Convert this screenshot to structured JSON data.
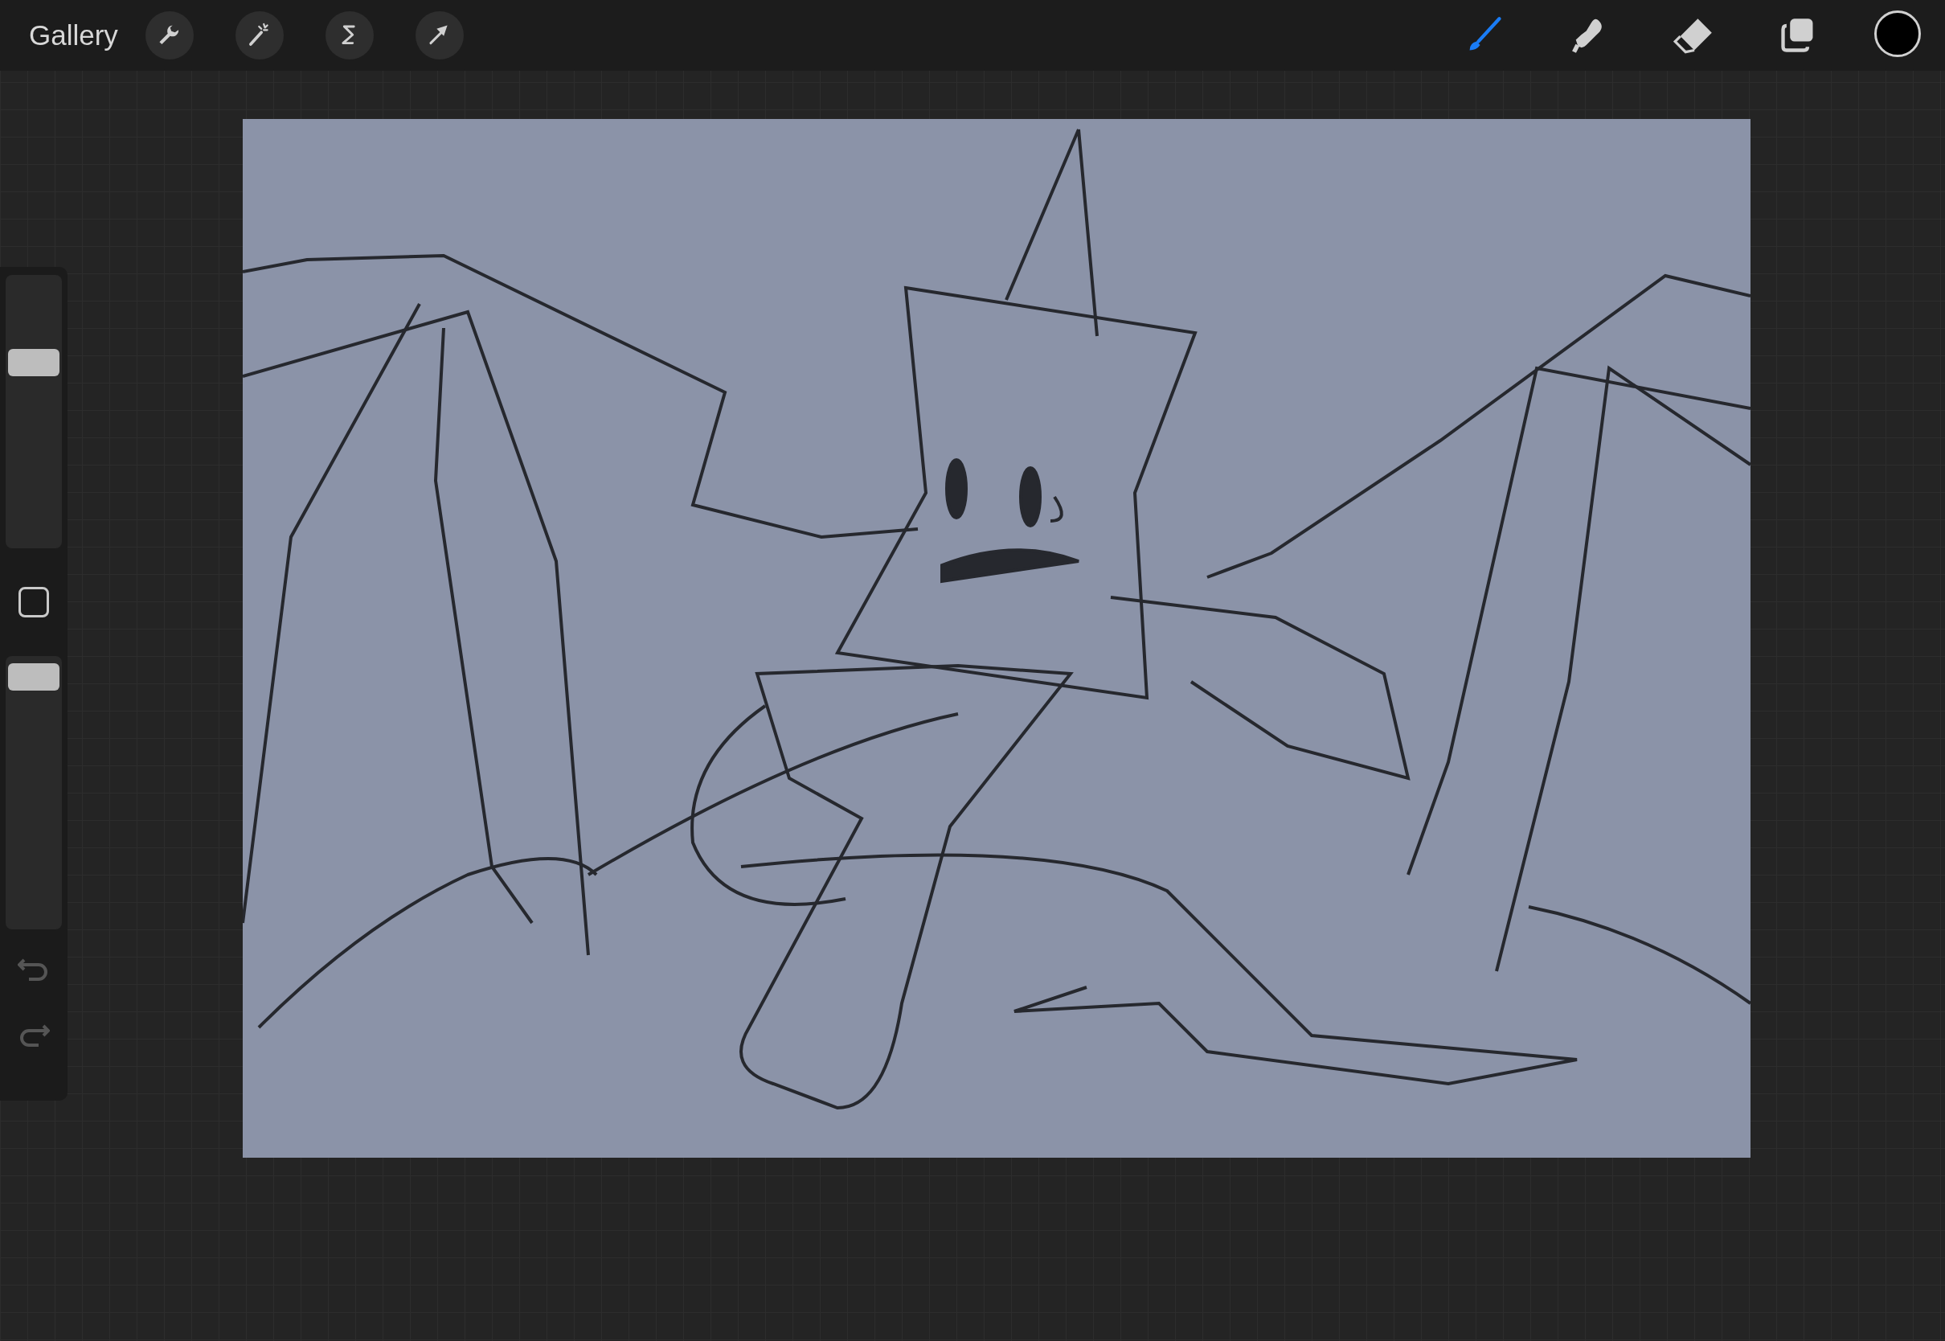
{
  "top_bar": {
    "gallery_label": "Gallery",
    "left_tools": [
      {
        "kind": "wrench",
        "selected": false
      },
      {
        "kind": "wand",
        "selected": false
      },
      {
        "kind": "selection",
        "selected": false
      },
      {
        "kind": "arrow",
        "selected": false
      }
    ],
    "right_tools": [
      {
        "kind": "brush",
        "selected": true
      },
      {
        "kind": "smudge",
        "selected": false
      },
      {
        "kind": "eraser",
        "selected": false
      },
      {
        "kind": "layers",
        "selected": false
      }
    ],
    "color_swatch": {
      "color": "#000000"
    }
  },
  "sidebar": {
    "brush_size": {
      "level": 0.7
    },
    "opacity": {
      "level": 0.97
    }
  }
}
